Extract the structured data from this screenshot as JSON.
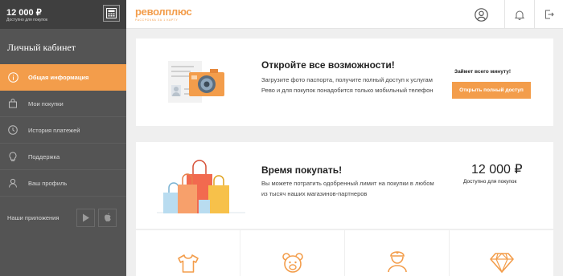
{
  "sidebar": {
    "balance": "12 000 ₽",
    "balance_caption": "Доступно для покупок",
    "title": "Личный кабинет",
    "items": [
      {
        "label": "Общая информация",
        "icon": "info-icon"
      },
      {
        "label": "Мои покупки",
        "icon": "bag-icon"
      },
      {
        "label": "История платежей",
        "icon": "clock-icon"
      },
      {
        "label": "Поддержка",
        "icon": "bulb-icon"
      },
      {
        "label": "Ваш профиль",
        "icon": "user-icon"
      }
    ],
    "apps_label": "Наши приложения"
  },
  "header": {
    "logo": "револплюс",
    "logo_tagline": "РАССРОЧКА ЗА 1 КАРТУ",
    "icons": [
      "profile-icon",
      "bell-icon",
      "logout-icon"
    ]
  },
  "promo": {
    "title": "Откройте все возможности!",
    "text": "Загрузите фото паспорта, получите полный доступ к услугам Рево и для покупок понадобится только мобильный телефон",
    "note": "Займет всего минуту!",
    "button": "Открыть полный доступ"
  },
  "shopping": {
    "title": "Время покупать!",
    "text": "Вы можете потратить одобренный лимит на покупки в любом из тысяч наших магазинов-партнеров",
    "limit": "12 000 ₽",
    "limit_caption": "Доступно для покупок"
  },
  "categories": [
    "tshirt-icon",
    "bear-icon",
    "doctor-icon",
    "diamond-icon"
  ],
  "colors": {
    "accent": "#f39d4b",
    "sidebar": "#545454",
    "sidebar_top": "#3f3f3f"
  }
}
